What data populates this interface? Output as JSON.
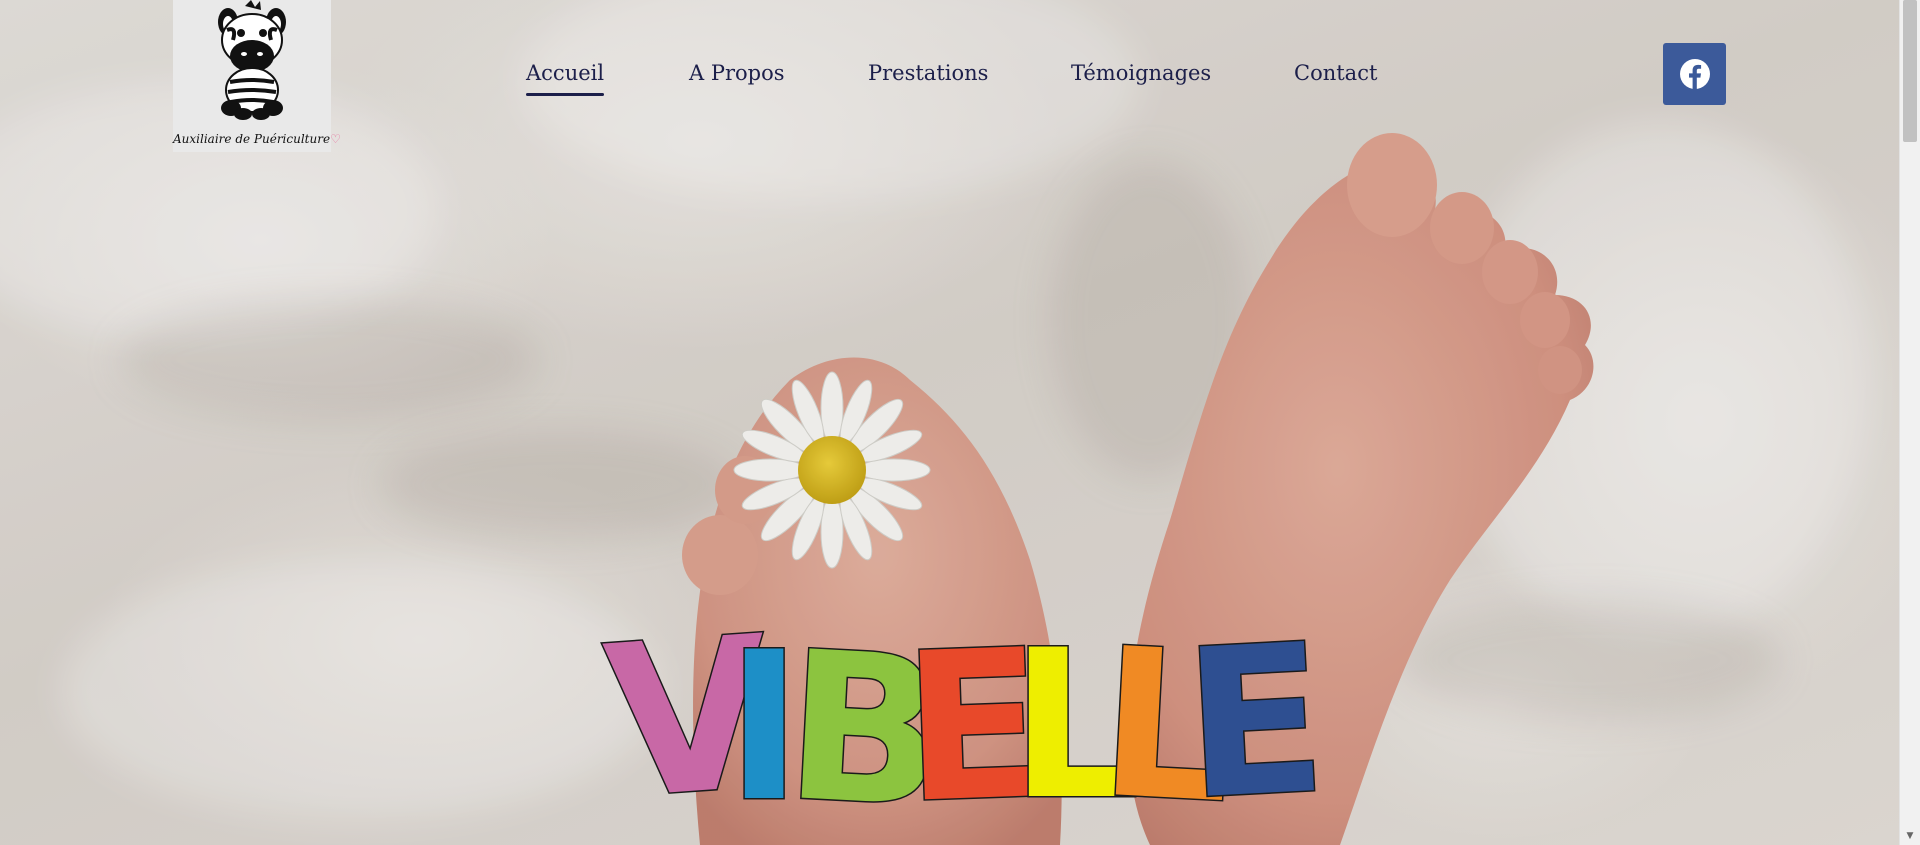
{
  "logo": {
    "caption": "Auxiliaire de Puériculture",
    "heart": "♡",
    "mascot_icon": "zebra-icon"
  },
  "nav": {
    "items": [
      {
        "label": "Accueil",
        "active": true
      },
      {
        "label": "A Propos",
        "active": false
      },
      {
        "label": "Prestations",
        "active": false
      },
      {
        "label": "Témoignages",
        "active": false
      },
      {
        "label": "Contact",
        "active": false
      }
    ],
    "text_color": "#1c1f4a"
  },
  "social": {
    "facebook_icon": "facebook-icon",
    "facebook_color": "#3c5a9a"
  },
  "hero": {
    "image_subject": "baby-feet-with-daisy-on-blanket",
    "brand": {
      "letters": [
        "V",
        "I",
        "B",
        "E",
        "L",
        "L",
        "E"
      ],
      "colors": [
        "#c868a6",
        "#1d8fc7",
        "#8cc43f",
        "#e8492a",
        "#eeee00",
        "#f08a24",
        "#2e4f91"
      ]
    }
  }
}
